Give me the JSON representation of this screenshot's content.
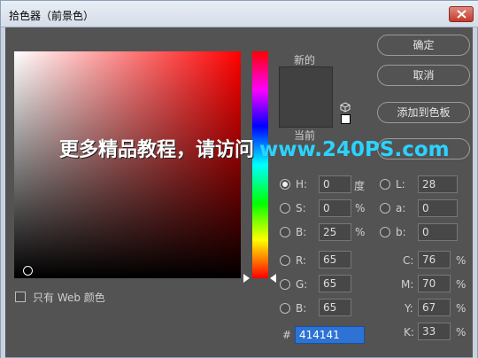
{
  "window": {
    "title": "拾色器（前景色）"
  },
  "labels": {
    "new": "新的",
    "current": "当前"
  },
  "buttons": {
    "ok": "确定",
    "cancel": "取消",
    "add_swatch": "添加到色板",
    "libraries": ""
  },
  "watermark": {
    "text_cn": "更多精品教程，请访问",
    "url": "www.240PS.com"
  },
  "web_only": {
    "label": "只有 Web 颜色",
    "checked": false
  },
  "hsb": [
    {
      "label": "H:",
      "value": "0",
      "unit": "度",
      "selected": true
    },
    {
      "label": "S:",
      "value": "0",
      "unit": "%",
      "selected": false
    },
    {
      "label": "B:",
      "value": "25",
      "unit": "%",
      "selected": false
    }
  ],
  "rgb": [
    {
      "label": "R:",
      "value": "65",
      "selected": false
    },
    {
      "label": "G:",
      "value": "65",
      "selected": false
    },
    {
      "label": "B:",
      "value": "65",
      "selected": false
    }
  ],
  "lab": [
    {
      "label": "L:",
      "value": "28",
      "selected": false
    },
    {
      "label": "a:",
      "value": "0",
      "selected": false
    },
    {
      "label": "b:",
      "value": "0",
      "selected": false
    }
  ],
  "cmyk": [
    {
      "label": "C:",
      "value": "76",
      "unit": "%"
    },
    {
      "label": "M:",
      "value": "70",
      "unit": "%"
    },
    {
      "label": "Y:",
      "value": "67",
      "unit": "%"
    },
    {
      "label": "K:",
      "value": "33",
      "unit": "%"
    }
  ],
  "hex": {
    "label": "#",
    "value": "414141"
  },
  "colors": {
    "new_color": "#414141",
    "dialog_bg": "#535353",
    "accent": "#2d73d6"
  }
}
